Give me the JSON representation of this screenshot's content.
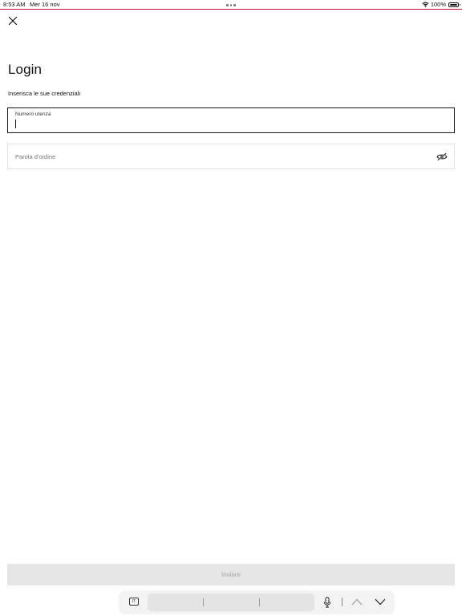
{
  "status_bar": {
    "time": "8:53 AM",
    "date": "Mer 16 nov",
    "battery": "100%",
    "battery_level": 1.0,
    "wifi_icon": "wifi-icon",
    "battery_icon": "battery-icon"
  },
  "header": {
    "close_icon": "close-icon",
    "accent_color": "#c8102e"
  },
  "form": {
    "title": "Login",
    "subtitle": "Inserisca le sue credenziali",
    "username": {
      "label": "Numero utenza",
      "value": ""
    },
    "password": {
      "placeholder": "Parola d'ordine",
      "value": "",
      "toggle_icon": "eye-slash-icon"
    },
    "submit_label": "Inviare"
  },
  "keyboard_bar": {
    "language": "IT",
    "mic_icon": "microphone-icon",
    "prev_icon": "chevron-up-icon",
    "next_icon": "chevron-down-icon"
  }
}
